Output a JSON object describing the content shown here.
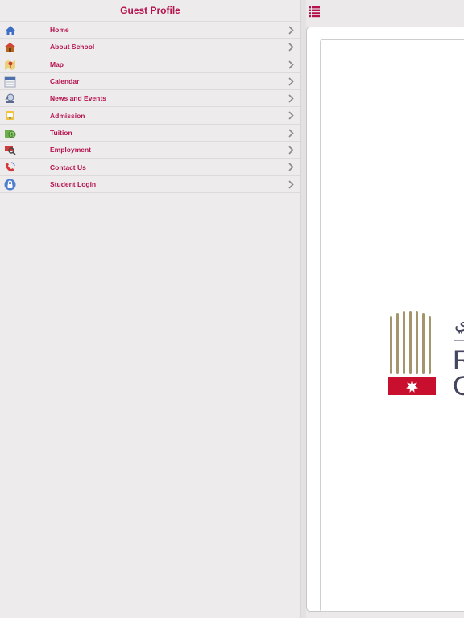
{
  "sidebar": {
    "title": "Guest Profile",
    "items": [
      {
        "label": "Home",
        "icon": "home-icon"
      },
      {
        "label": "About School",
        "icon": "school-icon"
      },
      {
        "label": "Map",
        "icon": "map-icon"
      },
      {
        "label": "Calendar",
        "icon": "calendar-icon"
      },
      {
        "label": "News and Events",
        "icon": "news-icon"
      },
      {
        "label": "Admission",
        "icon": "admission-icon"
      },
      {
        "label": "Tuition",
        "icon": "tuition-icon"
      },
      {
        "label": "Employment",
        "icon": "employment-icon"
      },
      {
        "label": "Contact Us",
        "icon": "phone-icon"
      },
      {
        "label": "Student Login",
        "icon": "lock-icon"
      }
    ]
  },
  "main": {
    "toolbar_icon": "list-icon",
    "logo": {
      "text_fragments": [
        "ي",
        "R",
        "O"
      ]
    }
  },
  "colors": {
    "accent": "#b5124e",
    "logo_gold": "#a3966c",
    "logo_red": "#c8102e",
    "logo_text": "#45455f"
  }
}
